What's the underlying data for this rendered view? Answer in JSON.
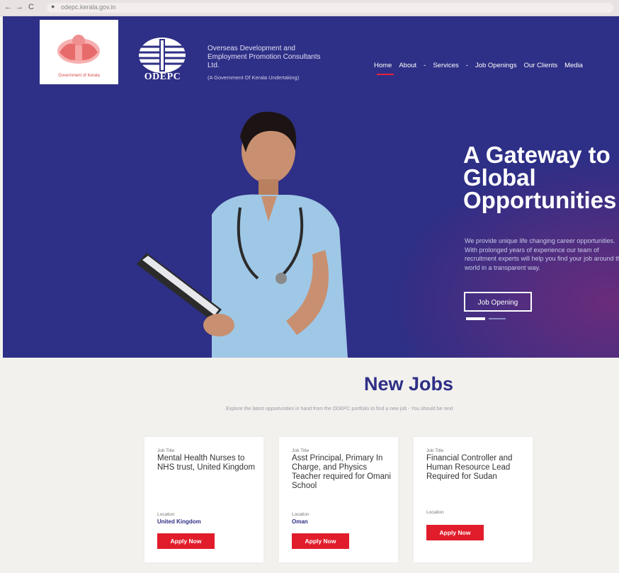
{
  "browser": {
    "back": "←",
    "forward": "→",
    "reload": "C",
    "url": "odepc.kerala.gov.in"
  },
  "header": {
    "kerala_caption": "Government of Kerala",
    "odepc_word": "ODEPC",
    "org_name": "Overseas Development and Employment Promotion Consultants Ltd.",
    "org_sub": "(A Government Of Kerala Undertaking)"
  },
  "nav": {
    "items": [
      "Home",
      "About",
      "Services",
      "Job Openings",
      "Our Clients",
      "Media"
    ],
    "separator": "-",
    "active_color": "#e8233a"
  },
  "hero": {
    "title": "A Gateway to\nGlobal\nOpportunities",
    "description": "We provide unique life changing career opportunities. With prolonged years of experience our team of recruitment experts will help you find your job around the world in a transparent way.",
    "button_label": "Job Opening",
    "bg_color": "#2e2f86"
  },
  "jobs": {
    "title": "New Jobs",
    "subtitle": "Explore the latest opportunities in hand from the ODEPC portfolio to find a new job - You should be next",
    "cards": [
      {
        "label": "Job Title",
        "title": "Mental Health Nurses to NHS trust, United Kingdom",
        "location_label": "Location",
        "location": "United Kingdom",
        "apply": "Apply Now"
      },
      {
        "label": "Job Title",
        "title": "Asst Principal, Primary In Charge, and Physics Teacher required for Omani School",
        "location_label": "Location",
        "location": "Oman",
        "apply": "Apply Now"
      },
      {
        "label": "Job Title",
        "title": "Financial Controller and Human Resource Lead Required for Sudan",
        "location_label": "Location",
        "location": "",
        "apply": "Apply Now"
      }
    ]
  },
  "colors": {
    "primary": "#2e2f86",
    "accent": "#e11d2b"
  },
  "icons": {
    "lock": "lock-icon",
    "emblem": "kerala-emblem-icon",
    "odepc_globe": "odepc-globe-icon"
  }
}
